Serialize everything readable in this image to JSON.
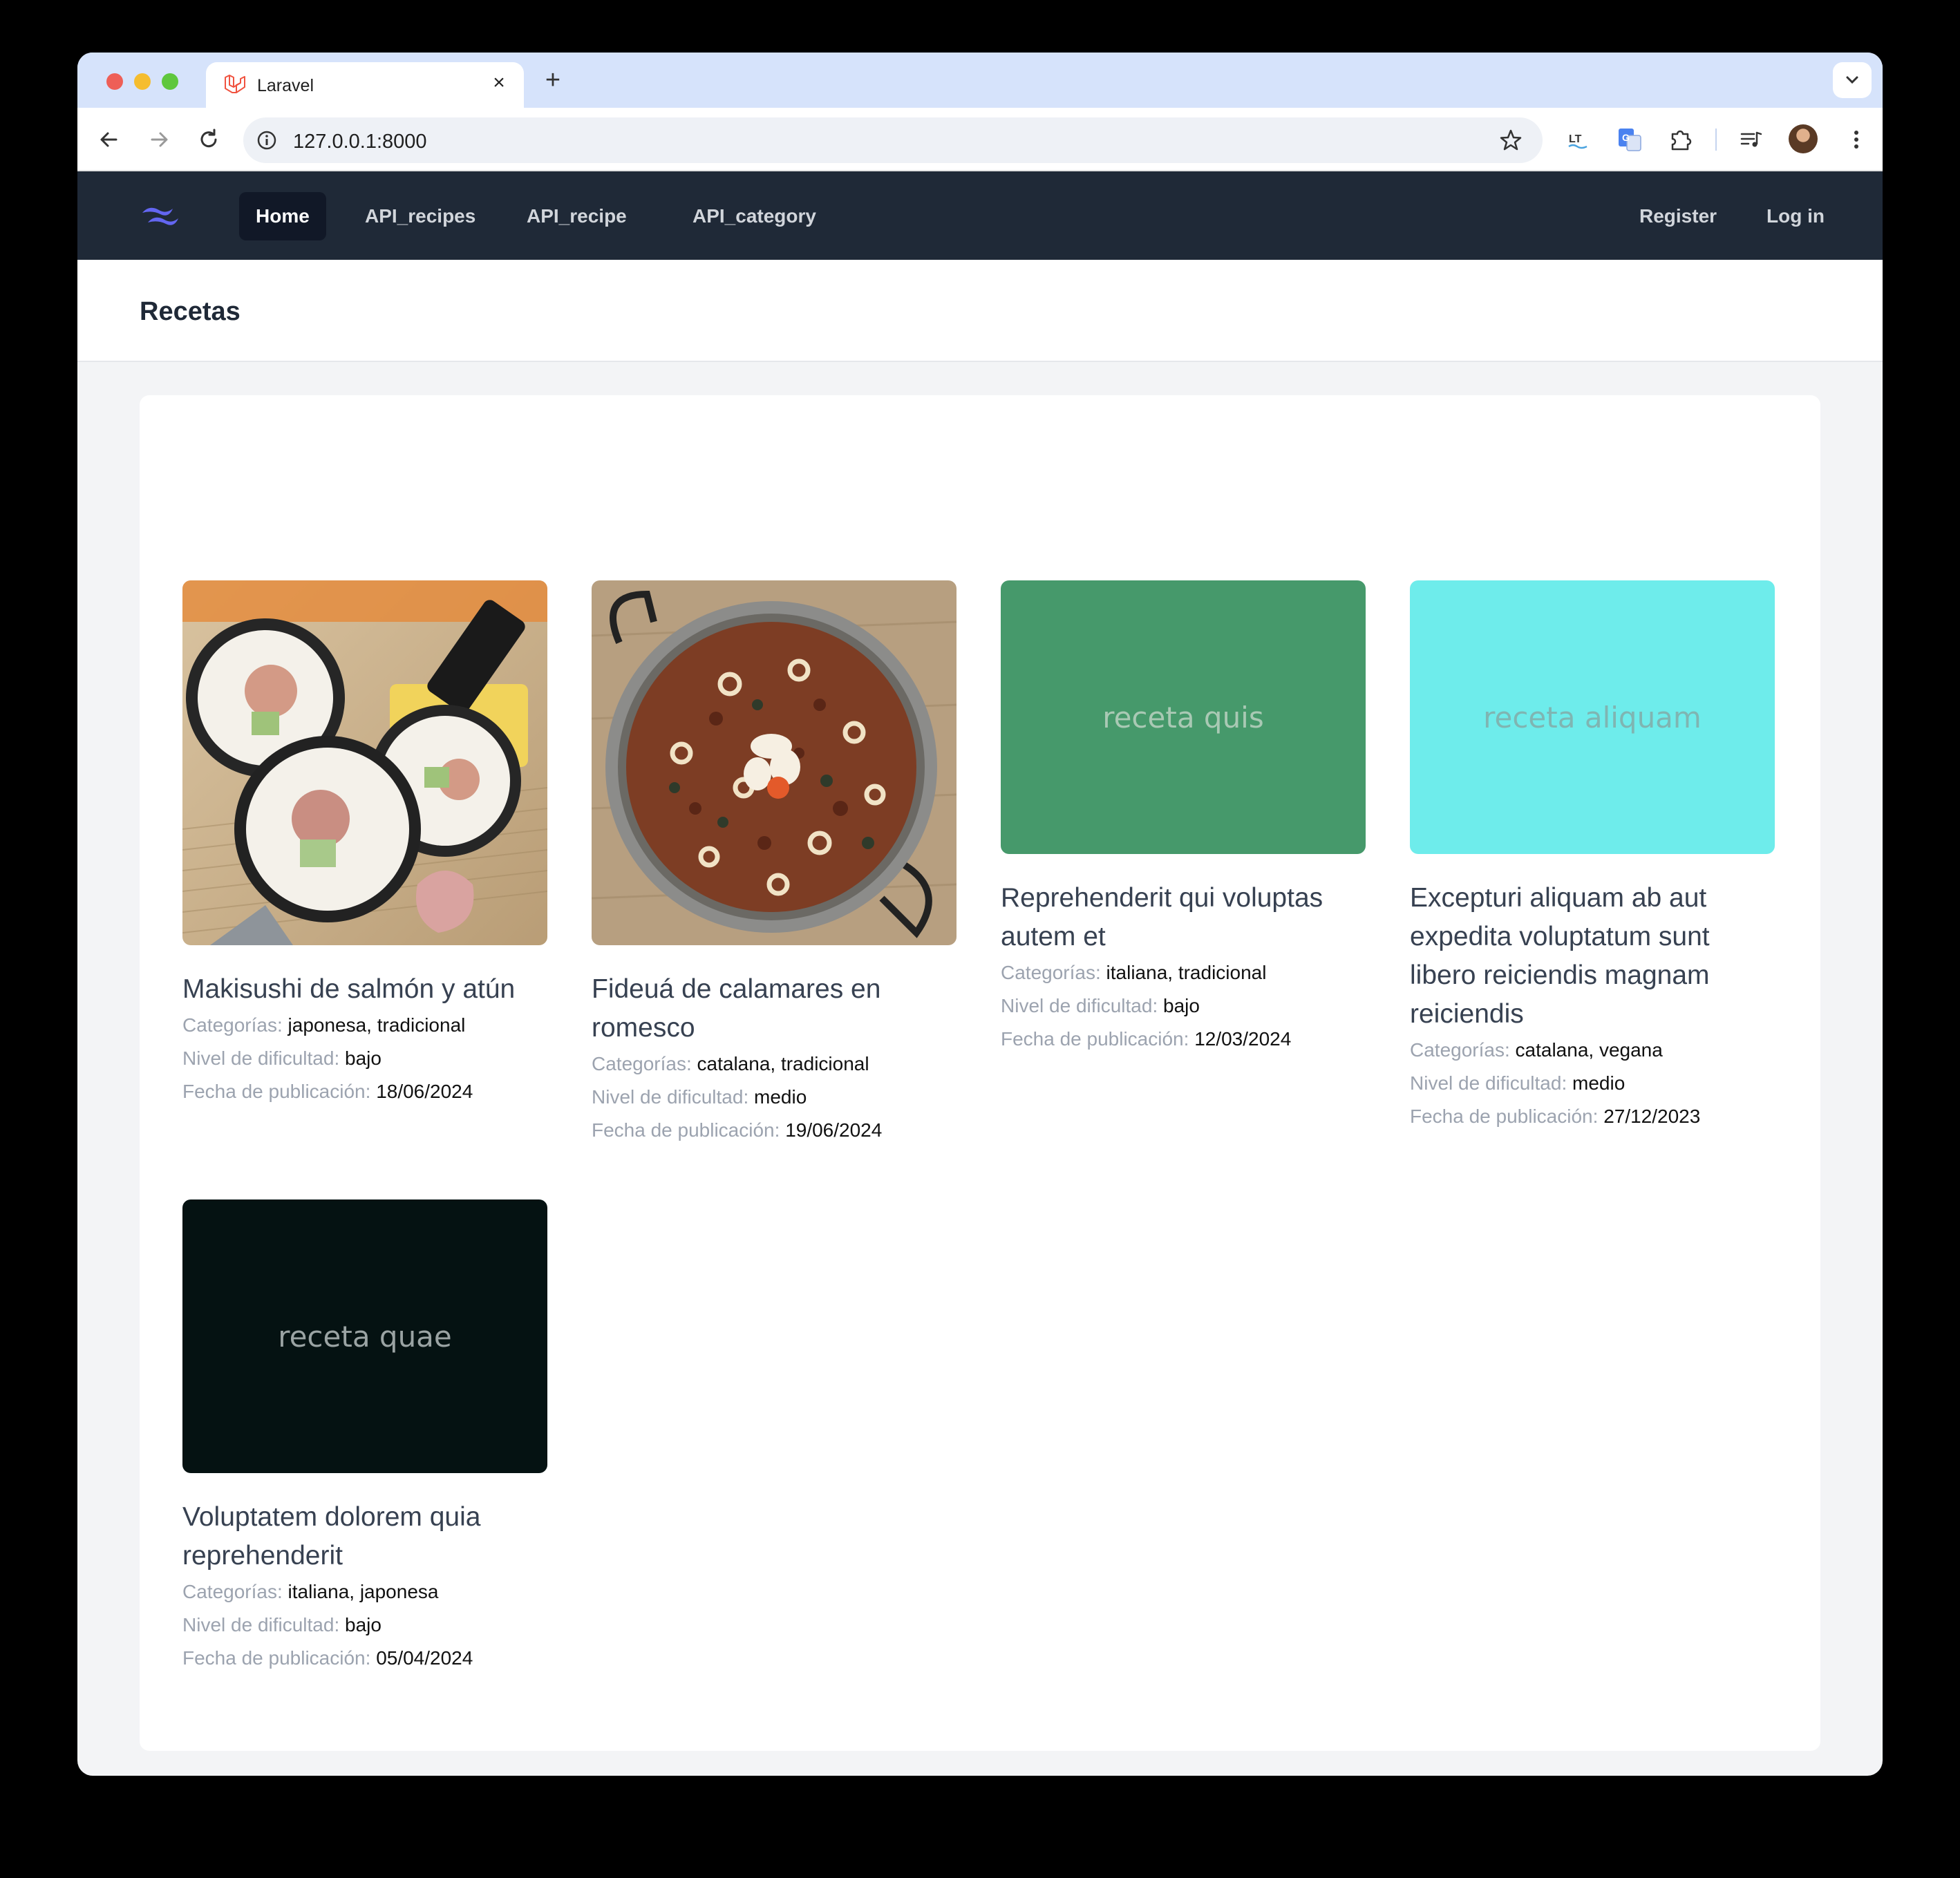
{
  "browser": {
    "tab_title": "Laravel",
    "tab_close": "×",
    "new_tab": "+",
    "url": "127.0.0.1:8000"
  },
  "nav": {
    "links": [
      "Home",
      "API_recipes",
      "API_recipe",
      "API_category"
    ],
    "register": "Register",
    "login": "Log in",
    "brand_color": "#6366f1",
    "bg_color": "#1f2937"
  },
  "page": {
    "title": "Recetas"
  },
  "labels": {
    "categories": "Categorías:",
    "difficulty": "Nivel de dificultad:",
    "date": "Fecha de publicación:"
  },
  "recipes": [
    {
      "title": "Makisushi de salmón y atún",
      "categories": "japonesa, tradicional",
      "difficulty": "bajo",
      "date": "18/06/2024",
      "image": "sushi-photo"
    },
    {
      "title": "Fideuá de calamares en romesco",
      "categories": "catalana, tradicional",
      "difficulty": "medio",
      "date": "19/06/2024",
      "image": "fideua-photo"
    },
    {
      "title": "Reprehenderit qui voluptas autem et",
      "categories": "italiana, tradicional",
      "difficulty": "bajo",
      "date": "12/03/2024",
      "placeholder_text": "receta quis",
      "placeholder_bg": "#46996b",
      "placeholder_fg": "#a9c9b4"
    },
    {
      "title": "Excepturi aliquam ab aut expedita voluptatum sunt libero reiciendis magnam reiciendis",
      "categories": "catalana, vegana",
      "difficulty": "medio",
      "date": "27/12/2023",
      "placeholder_text": "receta aliquam",
      "placeholder_bg": "#6eeceb",
      "placeholder_fg": "#7fb5b2"
    },
    {
      "title": "Voluptatem dolorem quia reprehenderit",
      "categories": "italiana, japonesa",
      "difficulty": "bajo",
      "date": "05/04/2024",
      "placeholder_text": "receta quae",
      "placeholder_bg": "#051212",
      "placeholder_fg": "#9aa3a3"
    }
  ]
}
